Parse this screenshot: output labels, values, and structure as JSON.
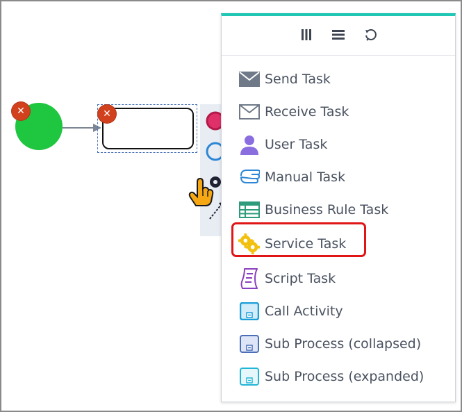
{
  "canvas": {
    "delete_badge_glyph": "✕",
    "colors": {
      "start_event": "#1fc63f",
      "delete_badge": "#d2411e",
      "menu_accent": "#1fc7b4",
      "highlight": "#e01515"
    }
  },
  "menu": {
    "header_buttons": [
      {
        "name": "columns-icon"
      },
      {
        "name": "list-icon"
      },
      {
        "name": "rotate-icon"
      }
    ],
    "items": [
      {
        "label": "Send Task",
        "icon": "envelope-filled-icon"
      },
      {
        "label": "Receive Task",
        "icon": "envelope-outline-icon"
      },
      {
        "label": "User Task",
        "icon": "user-icon"
      },
      {
        "label": "Manual Task",
        "icon": "hand-icon"
      },
      {
        "label": "Business Rule Task",
        "icon": "table-icon"
      },
      {
        "label": "Service Task",
        "icon": "gears-icon",
        "highlighted": true
      },
      {
        "label": "Script Task",
        "icon": "scroll-icon"
      },
      {
        "label": "Call Activity",
        "icon": "call-activity-icon"
      },
      {
        "label": "Sub Process (collapsed)",
        "icon": "subprocess-collapsed-icon"
      },
      {
        "label": "Sub Process (expanded)",
        "icon": "subprocess-expanded-icon"
      }
    ]
  }
}
